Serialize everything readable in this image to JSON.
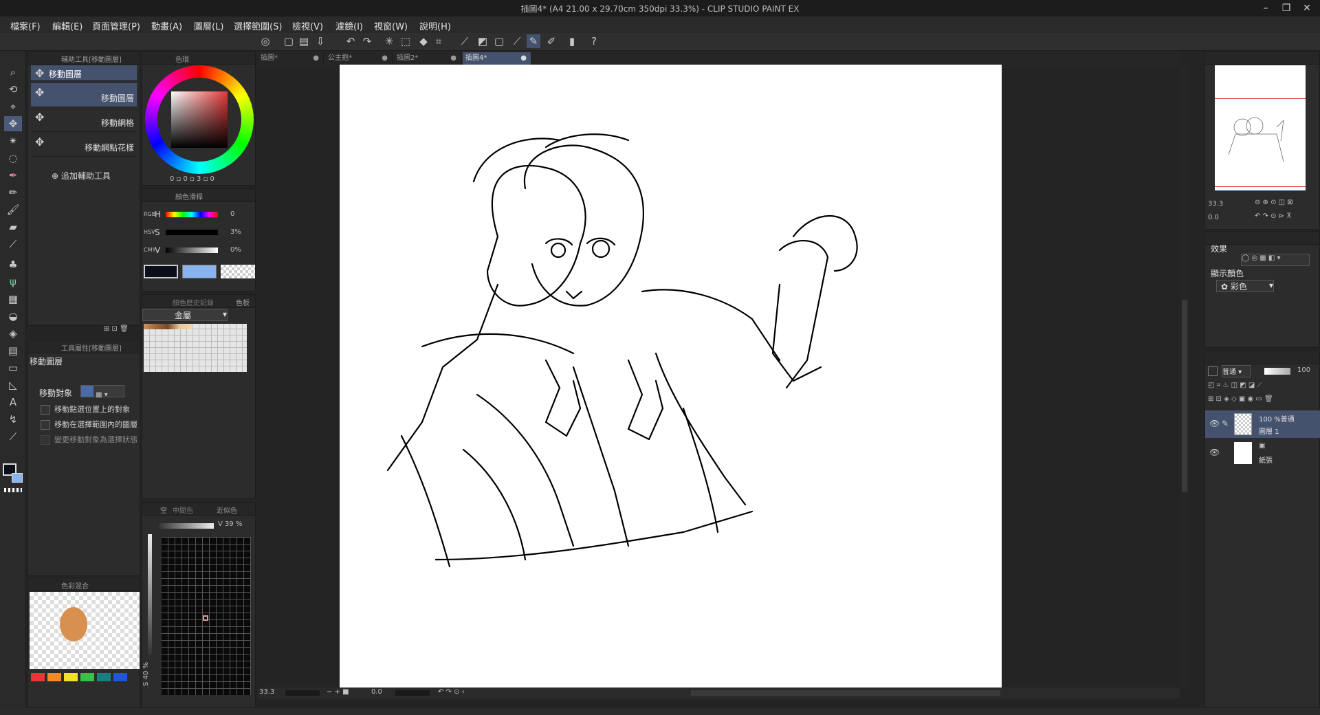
{
  "window": {
    "title": "插圖4* (A4 21.00 x 29.70cm 350dpi 33.3%)  - CLIP STUDIO PAINT EX"
  },
  "menu": [
    "檔案(F)",
    "編輯(E)",
    "頁面管理(P)",
    "動畫(A)",
    "圖層(L)",
    "選擇範圍(S)",
    "檢視(V)",
    "濾鏡(I)",
    "視窗(W)",
    "說明(H)"
  ],
  "doc_tabs": [
    "插圖*",
    "公主抱*",
    "插圖2*",
    "插圖4*"
  ],
  "subtool": {
    "header": "輔助工具[移動圖層]",
    "group": "移動圖層",
    "items": [
      "移動圖層",
      "移動網格",
      "移動網點花樣"
    ],
    "add_label": "追加輔助工具"
  },
  "tool_property": {
    "header": "工具屬性[移動圖層]",
    "title": "移動圖層",
    "target_label": "移動對象",
    "options": [
      "移動點選位置上的對象",
      "移動在選擇範圍內的圖層",
      "變更移動對象為選擇狀態"
    ]
  },
  "color_mix": {
    "header": "色彩混合"
  },
  "color_wheel": {
    "header": "色環",
    "values": [
      "0",
      "0",
      "3",
      "0"
    ]
  },
  "color_slider": {
    "header": "顏色滑桿",
    "modes": [
      "RGB",
      "HSV",
      "CMY"
    ],
    "rows": [
      {
        "label": "H",
        "value": "0"
      },
      {
        "label": "S",
        "value": "3%"
      },
      {
        "label": "V",
        "value": "0%"
      }
    ],
    "main_color": "#0b0f1a",
    "sub_color": "#8ab4f0"
  },
  "color_set": {
    "header": "色板",
    "history_header": "顏色歷史記錄",
    "set_name": "金屬"
  },
  "similar_color": {
    "header": "近似色",
    "tab2": "中間色",
    "tab1": "空",
    "v_value": "V  39 %",
    "s_value": "S 40 %"
  },
  "navigator": {
    "zoom": "33.3",
    "angle": "0.0"
  },
  "layer_property": {
    "effect_label": "效果",
    "display_color_label": "顯示顏色",
    "display_color_value": "彩色"
  },
  "layers": {
    "blend_mode": "普通",
    "opacity": "100",
    "items": [
      {
        "meta": "100 %普通",
        "name": "圖層 1"
      },
      {
        "meta": "",
        "name": "紙張"
      }
    ]
  },
  "status": {
    "zoom": "33.3",
    "angle": "0.0"
  }
}
